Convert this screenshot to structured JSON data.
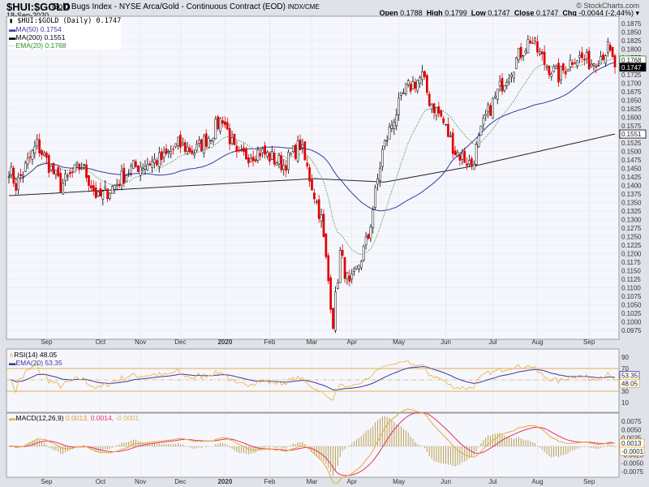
{
  "header": {
    "symbol": "$HUI:$GOLD",
    "description": "Gold Bugs Index - NYSE Arca/Gold - Continuous Contract (EOD)",
    "exchange": "INDX/CME",
    "date": "18-Sep-2020",
    "copyright": "© StockCharts.com",
    "open_label": "Open",
    "open": "0.1788",
    "high_label": "High",
    "high": "0.1799",
    "low_label": "Low",
    "low": "0.1747",
    "close_label": "Close",
    "close": "0.1747",
    "chg_label": "Chg",
    "chg": "-0.0044 (-2.44%)"
  },
  "legend": {
    "price": "$HUI:$GOLD (Daily) 0.1747",
    "ma50": "MA(50) 0.1754",
    "ma200": "MA(200) 0.1551",
    "ema20": "EMA(20) 0.1768",
    "rsi": "RSI(14) 48.05",
    "rsi_ema": "EMA(20) 53.35",
    "macd": "MACD(12,26,9)",
    "macd_v": "0.0013,",
    "macd_sig": "0.0014,",
    "macd_hist": "-0.0001"
  },
  "colors": {
    "up": "#000000",
    "down": "#e00000",
    "ma50": "#3a3aa0",
    "ma200": "#222222",
    "ema20": "#2a8a2a",
    "rsi": "#e8b040",
    "macd_signal": "#e83060"
  },
  "chart_data": {
    "type": "candlestick",
    "title": "$HUI:$GOLD (Daily)",
    "ylim": [
      0.0975,
      0.1875
    ],
    "yticks": [
      "0.1875",
      "0.1850",
      "0.1825",
      "0.1800",
      "0.1775",
      "0.1750",
      "0.1725",
      "0.1700",
      "0.1675",
      "0.1650",
      "0.1625",
      "0.1600",
      "0.1575",
      "0.1550",
      "0.1525",
      "0.1500",
      "0.1475",
      "0.1450",
      "0.1425",
      "0.1400",
      "0.1375",
      "0.1350",
      "0.1325",
      "0.1300",
      "0.1275",
      "0.1250",
      "0.1225",
      "0.1200",
      "0.1175",
      "0.1150",
      "0.1125",
      "0.1100",
      "0.1075",
      "0.1050",
      "0.1025",
      "0.1000",
      "0.0975"
    ],
    "months": [
      {
        "label": "Sep",
        "day": 16
      },
      {
        "label": "Oct",
        "day": 39
      },
      {
        "label": "Nov",
        "day": 56
      },
      {
        "label": "Dec",
        "day": 73
      },
      {
        "label": "2020",
        "day": 92
      },
      {
        "label": "Feb",
        "day": 111
      },
      {
        "label": "Mar",
        "day": 129
      },
      {
        "label": "Apr",
        "day": 146
      },
      {
        "label": "May",
        "day": 166
      },
      {
        "label": "Jun",
        "day": 186
      },
      {
        "label": "Jul",
        "day": 206
      },
      {
        "label": "Aug",
        "day": 225
      },
      {
        "label": "Sep",
        "day": 247
      }
    ],
    "days": 259,
    "close_keypoints": [
      [
        0,
        0.145
      ],
      [
        3,
        0.14
      ],
      [
        12,
        0.152
      ],
      [
        22,
        0.14
      ],
      [
        31,
        0.146
      ],
      [
        38,
        0.136
      ],
      [
        45,
        0.14
      ],
      [
        52,
        0.145
      ],
      [
        66,
        0.148
      ],
      [
        72,
        0.152
      ],
      [
        79,
        0.15
      ],
      [
        86,
        0.155
      ],
      [
        91,
        0.16
      ],
      [
        97,
        0.148
      ],
      [
        107,
        0.15
      ],
      [
        117,
        0.146
      ],
      [
        124,
        0.152
      ],
      [
        129,
        0.14
      ],
      [
        133,
        0.13
      ],
      [
        138,
        0.1
      ],
      [
        141,
        0.12
      ],
      [
        145,
        0.11
      ],
      [
        148,
        0.115
      ],
      [
        153,
        0.125
      ],
      [
        159,
        0.15
      ],
      [
        164,
        0.16
      ],
      [
        169,
        0.168
      ],
      [
        176,
        0.172
      ],
      [
        179,
        0.165
      ],
      [
        184,
        0.16
      ],
      [
        190,
        0.15
      ],
      [
        197,
        0.146
      ],
      [
        203,
        0.16
      ],
      [
        210,
        0.17
      ],
      [
        217,
        0.178
      ],
      [
        222,
        0.183
      ],
      [
        228,
        0.176
      ],
      [
        234,
        0.172
      ],
      [
        241,
        0.178
      ],
      [
        248,
        0.176
      ],
      [
        255,
        0.18
      ],
      [
        258,
        0.1747
      ]
    ],
    "ma200_keypoints": [
      [
        0,
        0.137
      ],
      [
        130,
        0.142
      ],
      [
        160,
        0.141
      ],
      [
        200,
        0.146
      ],
      [
        258,
        0.1551
      ]
    ],
    "last_values": {
      "close": "0.1747",
      "ema20": "0.1768",
      "ma200": "0.1551"
    },
    "rsi": {
      "ylim": [
        0,
        100
      ],
      "yticks": [
        "90",
        "70",
        "30",
        "10"
      ],
      "last": "48.05",
      "ema_last": "53.35"
    },
    "macd": {
      "ylim": [
        -0.009,
        0.009
      ],
      "yticks": [
        "0.0075",
        "0.0050",
        "0.0025",
        "-0.0025",
        "-0.0050",
        "-0.0075"
      ],
      "last": "0.0013",
      "hist_last": "-0.0001"
    }
  }
}
